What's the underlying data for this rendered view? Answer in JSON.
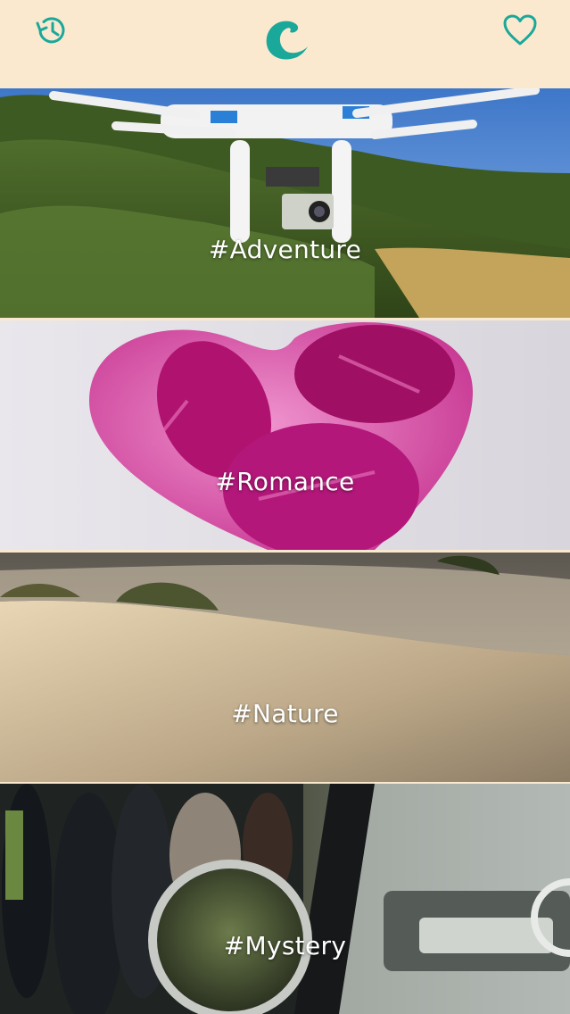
{
  "header": {
    "history_icon": "history-clock-icon",
    "logo_icon": "c-logo-icon",
    "favorites_icon": "heart-outline-icon",
    "accent_color": "#1aa89a",
    "background_color": "#fbe9cf"
  },
  "categories": [
    {
      "label": "#Adventure",
      "image": "drone-over-hills"
    },
    {
      "label": "#Romance",
      "image": "pink-heart-chocolates"
    },
    {
      "label": "#Nature",
      "image": "sand-dune"
    },
    {
      "label": "#Mystery",
      "image": "vintage-car-mirror-crowd"
    }
  ]
}
